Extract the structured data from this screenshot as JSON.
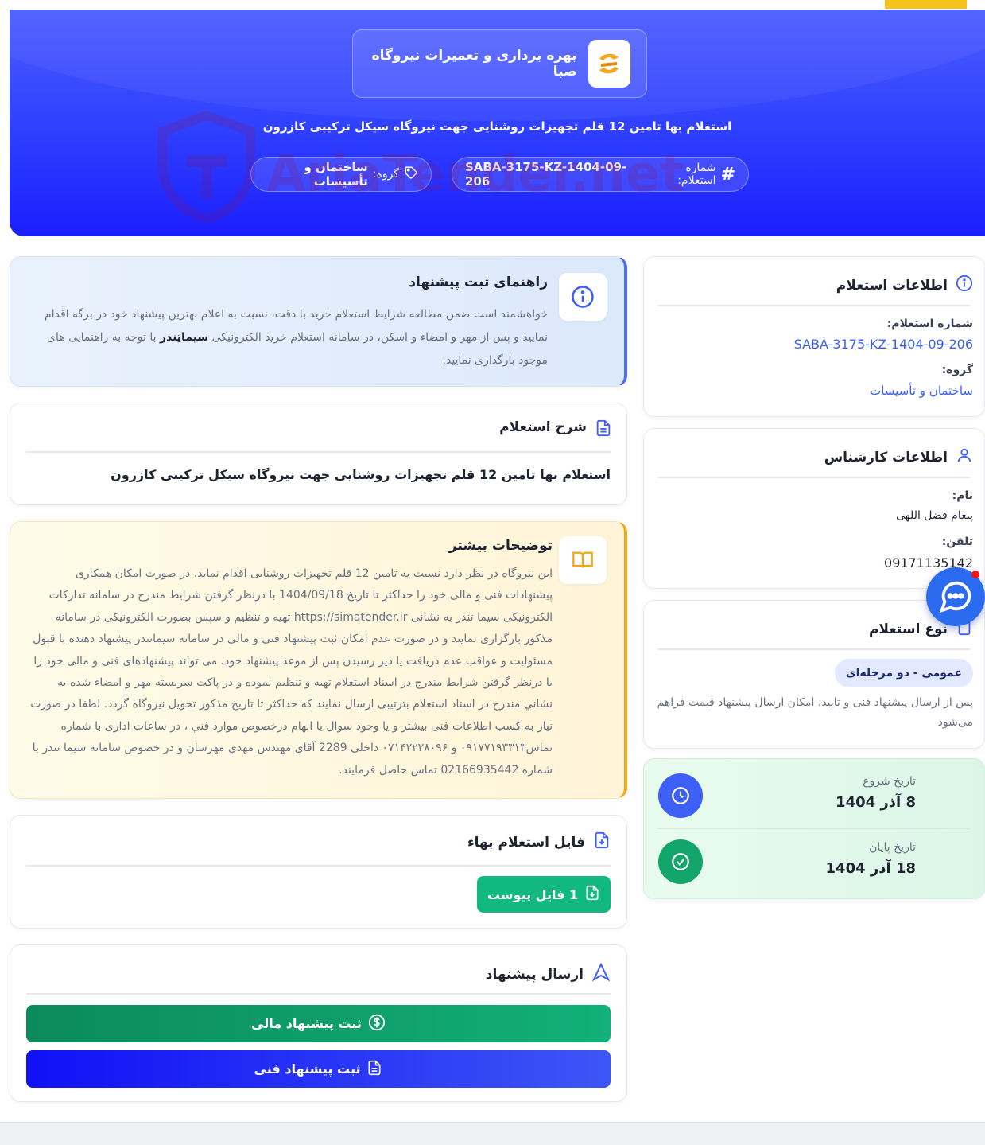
{
  "header": {
    "company_name": "بهره برداری و تعمیرات نیروگاه صبا",
    "title": "استعلام بها تامین 12 قلم تجهیزات روشنایی جهت نیروگاه سیکل ترکیبی کازرون",
    "inquiry_number_label": "شماره استعلام:",
    "inquiry_number": "SABA-3175-KZ-1404-09-206",
    "group_label": "گروه:",
    "group": "ساختمان و تأسیسات",
    "watermark": "AriaTender.net"
  },
  "guide": {
    "title": "راهنمای ثبت پیشنهاد",
    "text_1": "خواهشمند است ضمن مطالعه شرایط استعلام خرید با دقت، نسبت به اعلام بهترین پیشنهاد خود در برگه اقدام نمایید و پس از مهر و امضاء و اسکن، در سامانه استعلام خرید الکترونیکی",
    "brand": "سیماتِندر",
    "text_2": "با توجه به راهنمایی های موجود بارگذاری نمایید."
  },
  "description": {
    "title": "شرح استعلام",
    "text": "استعلام بها تامین 12 قلم تجهیزات روشنایی جهت نیروگاه سیکل ترکیبی کازرون"
  },
  "more": {
    "title": "توضیحات بیشتر",
    "text": "این نیروگاه در نظر دارد نسبت به تامین 12 قلم تجهیزات روشنایی اقدام نماید. در صورت امکان همکاری پیشنهادات فنی و مالی خود را حداکثر تا تاریخ 1404/09/18 با درنظر گرفتن شرایط مندرج در سامانه تداركات الکترونیکی سیما تندر به نشانی https://simatender.ir تهیه و تنظیم و سپس بصورت الکترونیکی در سامانه مذکور بارگزاری نمایند و در صورت عدم امکان ثبت پیشنهاد فنی و مالی در سامانه سیماتندر پیشنهاد دهنده با قبول مسئولیت و عواقب عدم دریافت یا دیر رسیدن پس از موعد پیشنهاد خود، می تواند پیشنهادهای فنی و مالی خود را با درنظر گرفتن شرایط مندرج در اسناد استعلام تهیه و تنظیم نموده و در پاکت سربسته مهر و امضاء شده به نشاني مندرج در اسناد استعلام بترتیبی ارسال نمایند که حداكثر تا تاریخ مذکور تحویل نیروگاه گردد. لطفا در صورت نیاز به کسب اطلاعات فنی بیشتر و یا وجود سوال یا ابهام درخصوص موارد فني ، در ساعات اداری با شماره تماس۰۹۱۷۷۱۹۳۳۱۳ و ۰۷۱۴۲۲۲۸۰۹۶ داخلی 2289 آقای مهندس مهدي مهرسان و در خصوص سامانه سیما تندر با شماره 02166935442 تماس حاصل فرمایند."
  },
  "file": {
    "title": "فایل استعلام بهاء",
    "button_label": "1 فایل پیوست"
  },
  "send": {
    "title": "ارسال پیشنهاد",
    "financial_label": "ثبت پیشنهاد مالی",
    "technical_label": "ثبت پیشنهاد فنی"
  },
  "info": {
    "title": "اطلاعات استعلام",
    "number_label": "شماره استعلام:",
    "number": "SABA-3175-KZ-1404-09-206",
    "group_label": "گروه:",
    "group": "ساختمان و تأسیسات"
  },
  "expert": {
    "title": "اطلاعات کارشناس",
    "name_label": "نام:",
    "name": "پیغام فضل اللهی",
    "phone_label": "تلفن:",
    "phone": "09171135142"
  },
  "type": {
    "title": "نوع استعلام",
    "badge": "عمومی - دو مرحله‌ای",
    "note": "پس از ارسال پیشنهاد فنی و تایید، امکان ارسال پیشنهاد قیمت فراهم می‌شود"
  },
  "dates": {
    "start_label": "تاریخ شروع",
    "start": "8 آذر 1404",
    "end_label": "تاریخ پایان",
    "end": "18 آذر 1404"
  },
  "colors": {
    "hero": "#2a37ff",
    "accent_green": "#11b981",
    "accent_blue": "#3d5ff5",
    "accent_orange": "#f2a81d",
    "chat": "#2b6bf0"
  }
}
